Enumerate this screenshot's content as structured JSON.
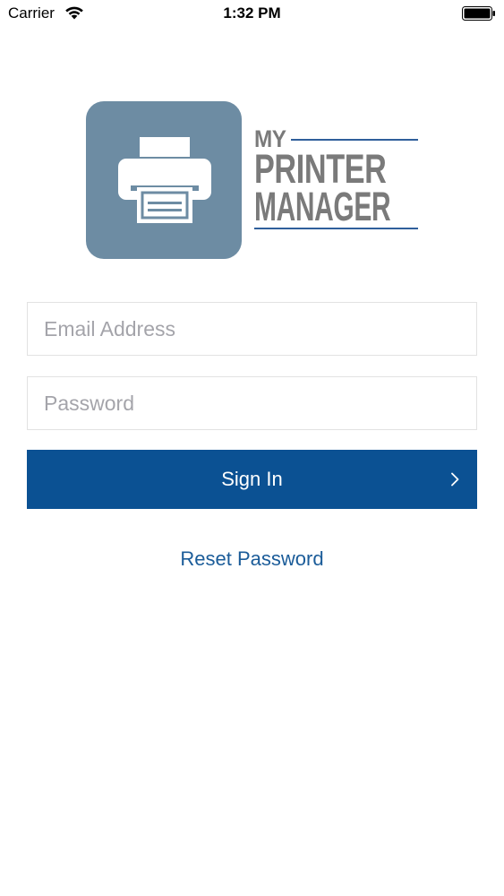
{
  "status_bar": {
    "carrier": "Carrier",
    "time": "1:32 PM",
    "wifi_icon": "wifi-icon",
    "battery_icon": "battery-icon"
  },
  "logo": {
    "icon": "printer-icon",
    "word_my": "MY",
    "word_printer": "PRINTER",
    "word_manager": "MANAGER",
    "tile_color": "#6d8ca3",
    "text_color": "#7a7a7a",
    "rule_color": "#2f5f9b"
  },
  "form": {
    "email": {
      "value": "",
      "placeholder": "Email Address"
    },
    "password": {
      "value": "",
      "placeholder": "Password"
    },
    "sign_in_label": "Sign In",
    "sign_in_icon": "chevron-right-icon",
    "reset_password_label": "Reset Password"
  },
  "colors": {
    "primary": "#0b5193",
    "link": "#1b5c99",
    "placeholder": "#a4a4aa",
    "field_border": "#e2e2e2"
  }
}
